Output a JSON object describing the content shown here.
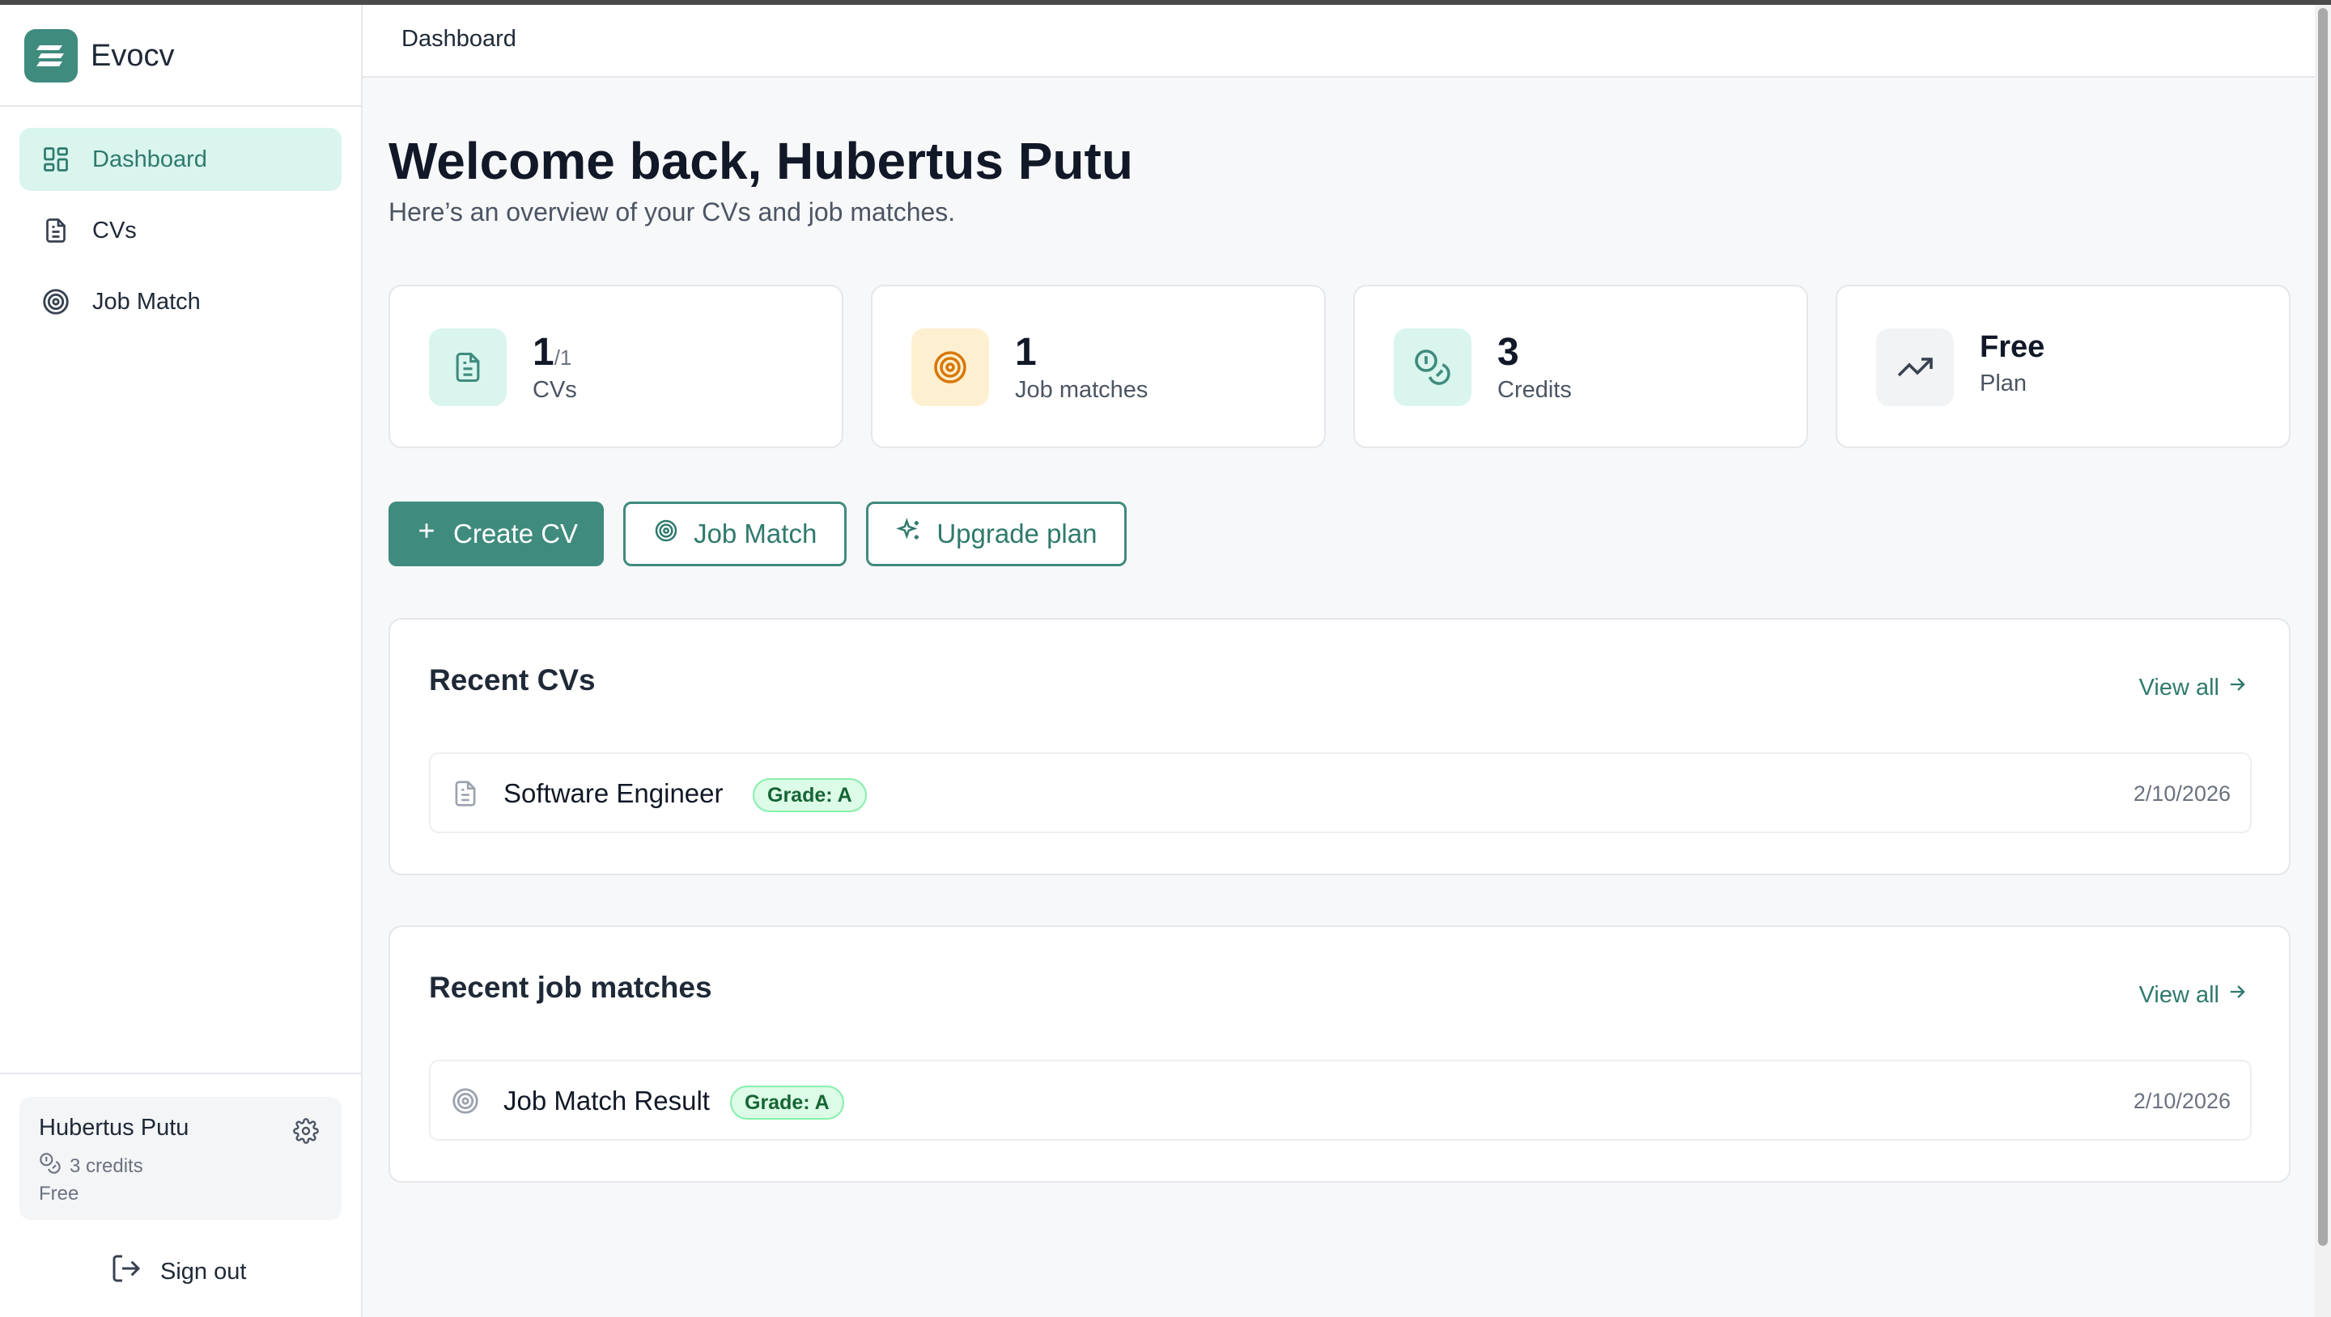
{
  "app": {
    "name": "Evocv"
  },
  "sidebar": {
    "items": [
      {
        "label": "Dashboard",
        "icon": "dashboard-grid-icon",
        "active": true
      },
      {
        "label": "CVs",
        "icon": "document-icon",
        "active": false
      },
      {
        "label": "Job Match",
        "icon": "target-icon",
        "active": false
      }
    ],
    "user": {
      "name": "Hubertus Putu",
      "credits": "3 credits",
      "plan": "Free"
    },
    "sign_out": "Sign out"
  },
  "header": {
    "breadcrumb": "Dashboard"
  },
  "main": {
    "welcome": "Welcome back, Hubertus Putu",
    "subtitle": "Here’s an overview of your CVs and job matches.",
    "stats": {
      "cvs": {
        "value": "1",
        "sub": "/1",
        "label": "CVs"
      },
      "matches": {
        "value": "1",
        "label": "Job matches"
      },
      "credits": {
        "value": "3",
        "label": "Credits"
      },
      "plan": {
        "value": "Free",
        "label": "Plan"
      }
    },
    "actions": {
      "create_cv": "Create CV",
      "job_match": "Job Match",
      "upgrade": "Upgrade plan"
    },
    "recent_cvs": {
      "title": "Recent CVs",
      "view_all": "View all",
      "items": [
        {
          "title": "Software Engineer",
          "grade": "Grade: A",
          "date": "2/10/2026"
        }
      ]
    },
    "recent_matches": {
      "title": "Recent job matches",
      "view_all": "View all",
      "items": [
        {
          "title": "Job Match Result",
          "grade": "Grade: A",
          "date": "2/10/2026"
        }
      ]
    }
  },
  "colors": {
    "brand": "#3f8b7e",
    "active_nav_bg": "#d9f5ee",
    "cv_tile": "#d9f5ee",
    "match_tile": "#fdf0d0",
    "credits_tile": "#d9f5ee",
    "plan_tile": "#f1f3f5",
    "grade_badge": "#dcfce7"
  }
}
